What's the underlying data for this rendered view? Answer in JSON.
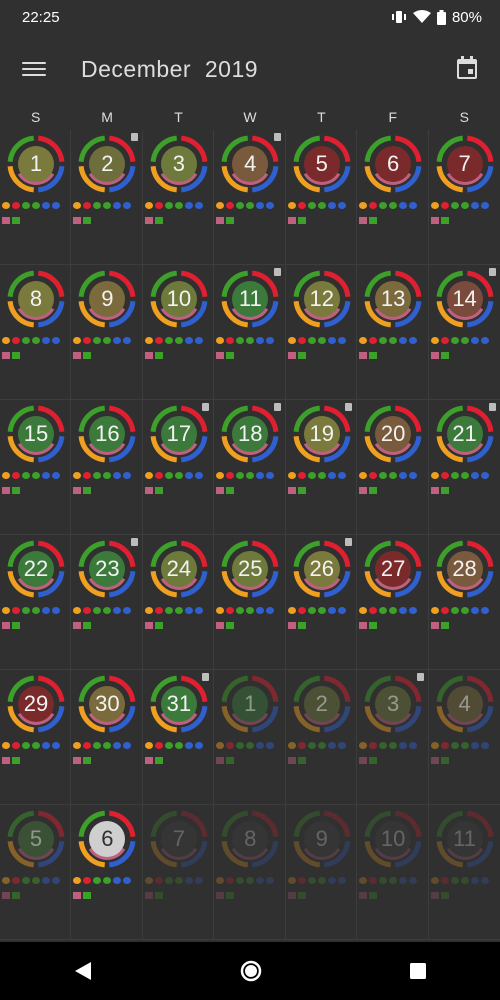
{
  "status": {
    "time": "22:25",
    "battery": "80%"
  },
  "header": {
    "title": "December  2019"
  },
  "weekdays": [
    "S",
    "M",
    "T",
    "W",
    "T",
    "F",
    "S"
  ],
  "days": [
    {
      "n": "1",
      "fill": "#7a7a3c",
      "note": false
    },
    {
      "n": "2",
      "fill": "#6e6e3c",
      "note": true
    },
    {
      "n": "3",
      "fill": "#6e7a3c",
      "note": false
    },
    {
      "n": "4",
      "fill": "#7a5a3c",
      "note": true
    },
    {
      "n": "5",
      "fill": "#7a2a2a",
      "note": false
    },
    {
      "n": "6",
      "fill": "#7a2a2a",
      "note": false
    },
    {
      "n": "7",
      "fill": "#7a2a2a",
      "note": false
    },
    {
      "n": "8",
      "fill": "#7a7a3c",
      "note": false
    },
    {
      "n": "9",
      "fill": "#7a6a3c",
      "note": false
    },
    {
      "n": "10",
      "fill": "#6e7a3c",
      "note": false
    },
    {
      "n": "11",
      "fill": "#3c7a3c",
      "note": true
    },
    {
      "n": "12",
      "fill": "#7a7a3c",
      "note": false
    },
    {
      "n": "13",
      "fill": "#7a6a3c",
      "note": false
    },
    {
      "n": "14",
      "fill": "#7a4a3c",
      "note": true
    },
    {
      "n": "15",
      "fill": "#3c7a3c",
      "note": false
    },
    {
      "n": "16",
      "fill": "#3c7a3c",
      "note": false
    },
    {
      "n": "17",
      "fill": "#3c7a3c",
      "note": true
    },
    {
      "n": "18",
      "fill": "#3c7a3c",
      "note": true
    },
    {
      "n": "19",
      "fill": "#7a7a3c",
      "note": true
    },
    {
      "n": "20",
      "fill": "#7a5a3c",
      "note": false
    },
    {
      "n": "21",
      "fill": "#3c7a3c",
      "note": true
    },
    {
      "n": "22",
      "fill": "#3c7a3c",
      "note": false
    },
    {
      "n": "23",
      "fill": "#3c7a3c",
      "note": true
    },
    {
      "n": "24",
      "fill": "#6e7a3c",
      "note": false
    },
    {
      "n": "25",
      "fill": "#6e7a3c",
      "note": false
    },
    {
      "n": "26",
      "fill": "#7a7a3c",
      "note": true
    },
    {
      "n": "27",
      "fill": "#7a2a2a",
      "note": false
    },
    {
      "n": "28",
      "fill": "#7a5a3c",
      "note": false
    },
    {
      "n": "29",
      "fill": "#7a2a2a",
      "note": false
    },
    {
      "n": "30",
      "fill": "#7a6a3c",
      "note": false
    },
    {
      "n": "31",
      "fill": "#3c7a3c",
      "note": true
    },
    {
      "n": "1",
      "fill": "#3c7a3c",
      "note": false
    },
    {
      "n": "2",
      "fill": "#6e7a3c",
      "note": false
    },
    {
      "n": "3",
      "fill": "#6e7a3c",
      "note": true
    },
    {
      "n": "4",
      "fill": "#7a6a3c",
      "note": false
    },
    {
      "n": "5",
      "fill": "#4a7a3c",
      "note": false
    },
    {
      "n": "6",
      "fill": "#cfcfcf",
      "note": false
    },
    {
      "n": "7",
      "fill": "#444444",
      "note": false
    },
    {
      "n": "8",
      "fill": "#444444",
      "note": false
    },
    {
      "n": "9",
      "fill": "#444444",
      "note": false
    },
    {
      "n": "10",
      "fill": "#444444",
      "note": false
    },
    {
      "n": "11",
      "fill": "#444444",
      "note": false
    }
  ],
  "colors": {
    "green": "#3ca02a",
    "red": "#e02030",
    "blue": "#3060d0",
    "orange": "#f0a020",
    "pink": "#c06080"
  }
}
